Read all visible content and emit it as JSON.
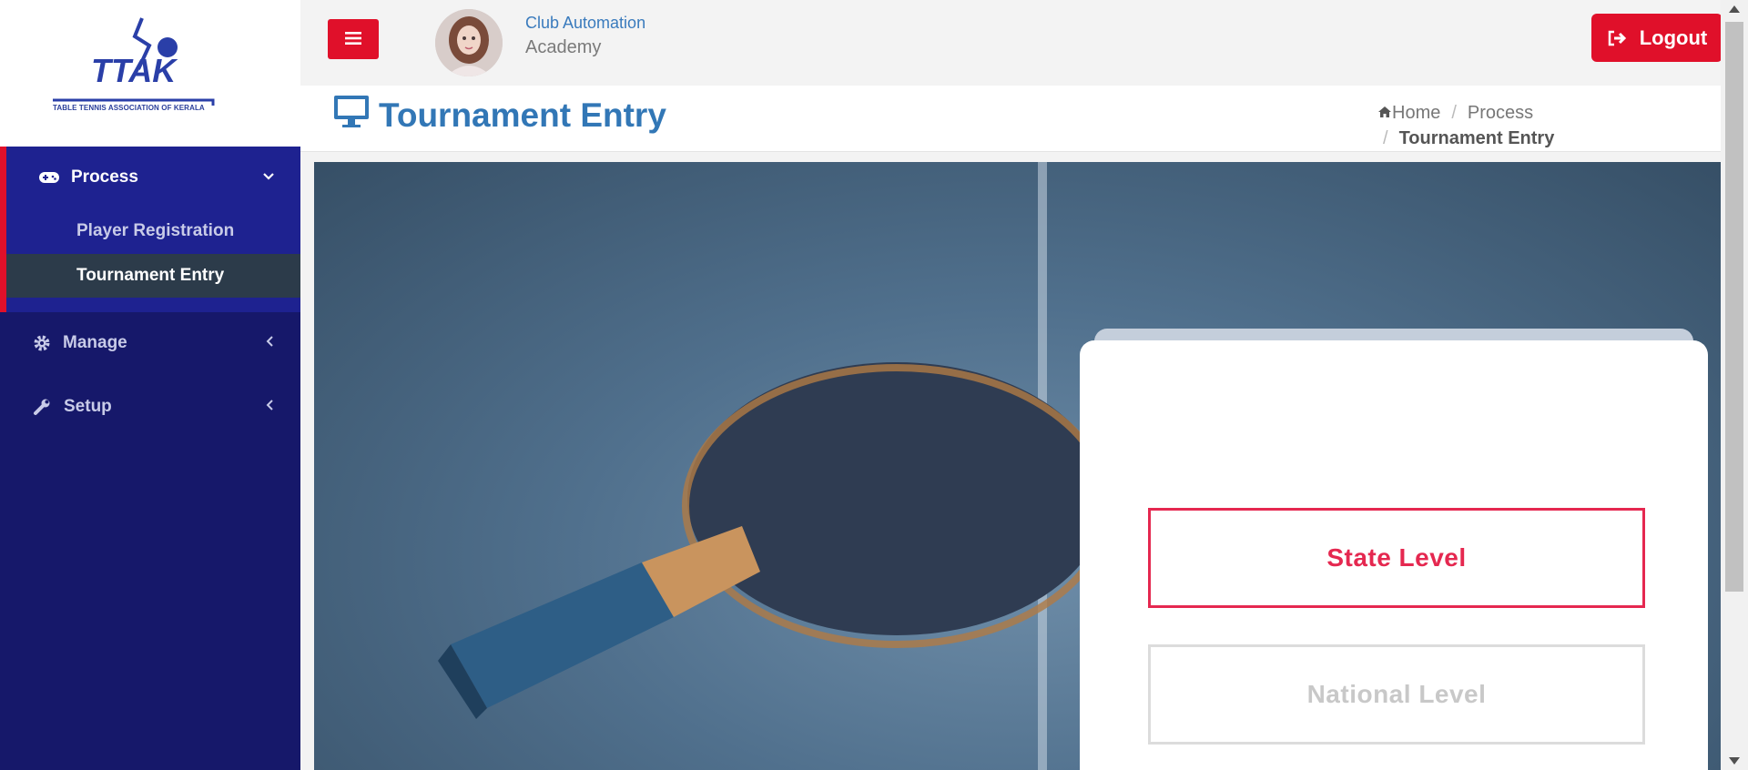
{
  "sidebar": {
    "logo": {
      "mark_text": "TTAK",
      "caption": "TABLE TENNIS ASSOCIATION OF KERALA"
    },
    "process": {
      "label": "Process",
      "icon": "gamepad-icon",
      "items": [
        {
          "label": "Player Registration",
          "active": false
        },
        {
          "label": "Tournament Entry",
          "active": true
        }
      ]
    },
    "manage": {
      "label": "Manage",
      "icon": "gear-icon"
    },
    "setup": {
      "label": "Setup",
      "icon": "wrench-icon"
    }
  },
  "header": {
    "menu_icon": "hamburger-icon",
    "org_name": "Club Automation",
    "org_subtitle": "Academy",
    "logout_label": "Logout",
    "logout_icon": "sign-out-icon"
  },
  "page": {
    "title": "Tournament Entry",
    "title_icon": "desktop-icon",
    "breadcrumb": {
      "home": "Home",
      "section": "Process",
      "separator": "/",
      "current": "Tournament Entry"
    }
  },
  "selection": {
    "state_label": "State Level",
    "national_label": "National Level"
  },
  "colors": {
    "brand_red": "#e0102a",
    "sidebar_bg": "#16186a",
    "title_blue": "#3277b6",
    "state_accent": "#e52850"
  }
}
